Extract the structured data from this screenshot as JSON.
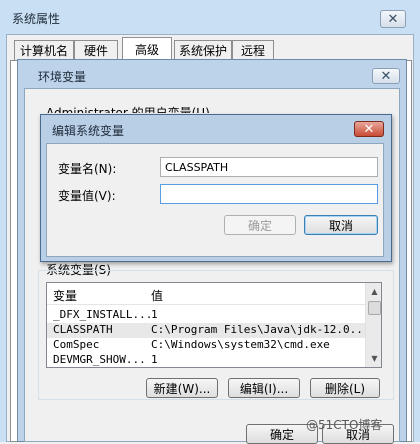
{
  "outer": {
    "title": "系统属性",
    "tabs": [
      "计算机名",
      "硬件",
      "高级",
      "系统保护",
      "远程"
    ],
    "active_tab": "高级"
  },
  "env": {
    "title": "环境变量",
    "user_vars_label_partial": "Administrator 的用户变量(U)",
    "system_vars_label": "系统变量(S)",
    "columns": [
      "变量",
      "值"
    ],
    "rows": [
      {
        "name": "_DFX_INSTALL...",
        "value": "1"
      },
      {
        "name": "CLASSPATH",
        "value": "C:\\Program Files\\Java\\jdk-12.0...."
      },
      {
        "name": "ComSpec",
        "value": "C:\\Windows\\system32\\cmd.exe"
      },
      {
        "name": "DEVMGR_SHOW...",
        "value": "1"
      }
    ],
    "selected_row": 1,
    "buttons": {
      "new": "新建(W)...",
      "edit": "编辑(I)...",
      "delete": "删除(L)"
    },
    "ok": "确定",
    "cancel": "取消"
  },
  "edit": {
    "title": "编辑系统变量",
    "name_label": "变量名(N):",
    "value_label": "变量值(V):",
    "name_value": "CLASSPATH",
    "value_value": "",
    "ok": "确定",
    "cancel": "取消"
  },
  "icons": {
    "close": "close-icon",
    "scroll_up": "chevron-up-icon",
    "scroll_down": "chevron-down-icon"
  },
  "watermark": "@51CTO博客"
}
